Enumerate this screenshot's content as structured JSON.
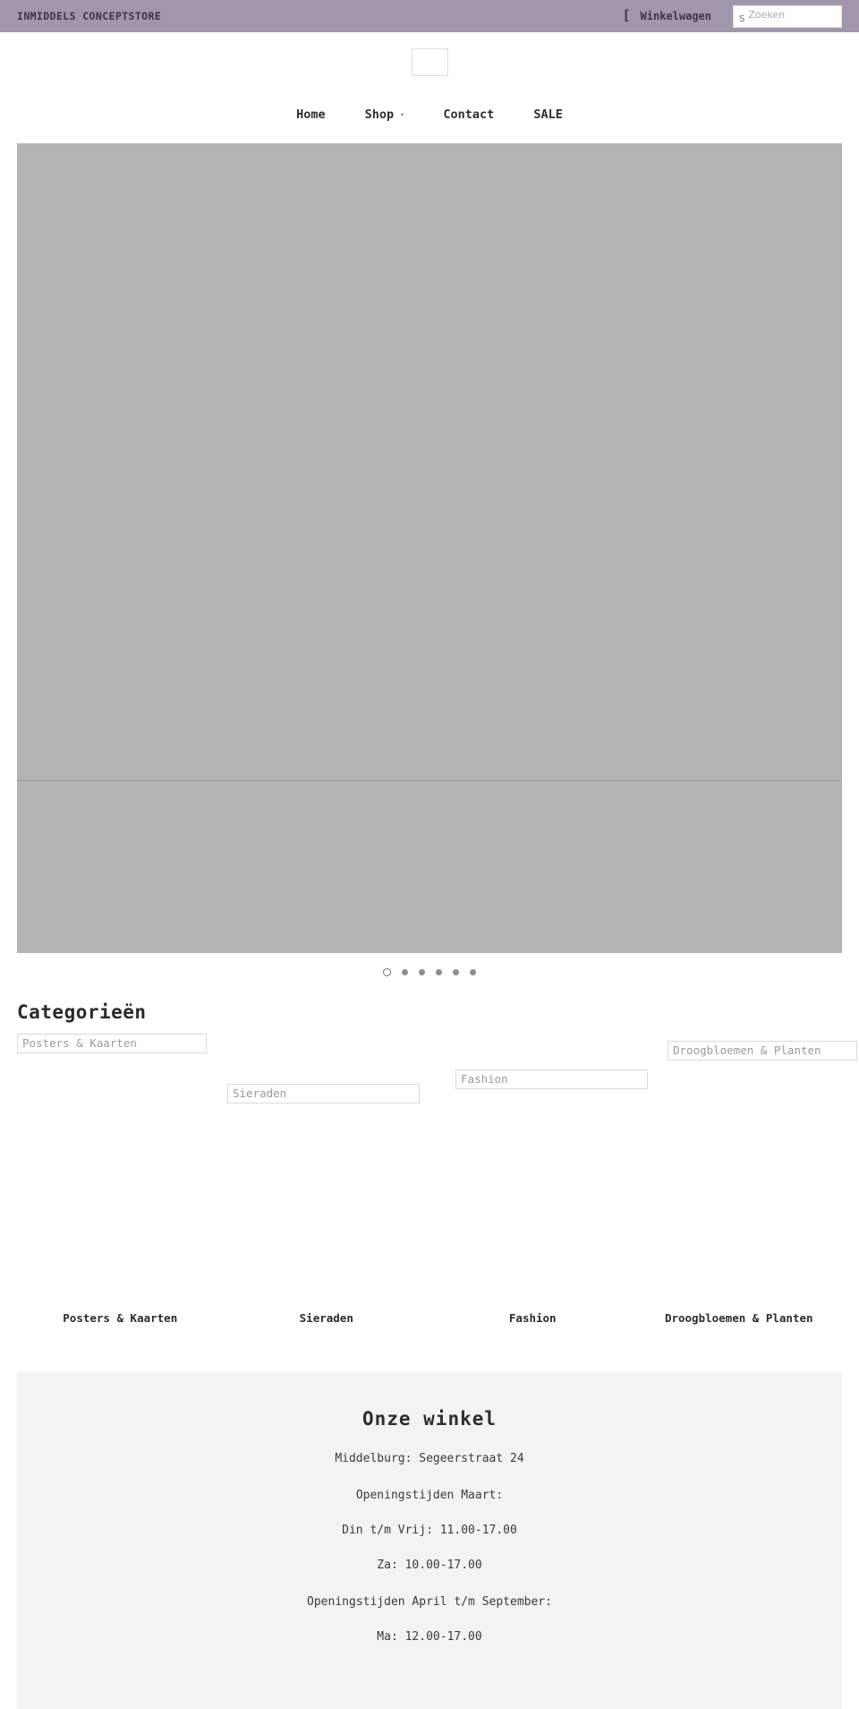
{
  "topbar": {
    "brand": "INMIDDELS CONCEPTSTORE",
    "cart_label": "Winkelwagen",
    "cart_icon": "shopping-bag-icon",
    "search_icon": "search-icon",
    "search_glyph": "S",
    "search_placeholder": "Zoeken",
    "search_value": "",
    "bg_color": "#a296ad"
  },
  "header": {
    "logo_alt": ""
  },
  "nav": {
    "items": [
      {
        "label": "Home",
        "has_caret": false,
        "caret": ""
      },
      {
        "label": "Shop",
        "has_caret": true,
        "caret": "▾"
      },
      {
        "label": "Contact",
        "has_caret": false,
        "caret": ""
      },
      {
        "label": "SALE",
        "has_caret": false,
        "caret": ""
      }
    ]
  },
  "hero": {
    "slides_count": 6,
    "active_slide": 1,
    "dots": [
      "1",
      "2",
      "3",
      "4",
      "5",
      "6"
    ]
  },
  "categories": {
    "title": "Categorieën",
    "items": [
      {
        "alt": "Posters & Kaarten",
        "label": "Posters & Kaarten"
      },
      {
        "alt": "Sieraden",
        "label": "Sieraden"
      },
      {
        "alt": "Fashion",
        "label": "Fashion"
      },
      {
        "alt": "Droogbloemen & Planten",
        "label": "Droogbloemen & Planten"
      }
    ]
  },
  "store": {
    "title": "Onze winkel",
    "address": "Middelburg: Segeerstraat 24",
    "hours_heading_1": "Openingstijden Maart:",
    "hours_1_line_1": "Din t/m Vrij: 11.00-17.00",
    "hours_1_line_2": "Za: 10.00-17.00",
    "hours_heading_2": "Openingstijden April t/m September:",
    "hours_2_line_1": "Ma: 12.00-17.00"
  }
}
